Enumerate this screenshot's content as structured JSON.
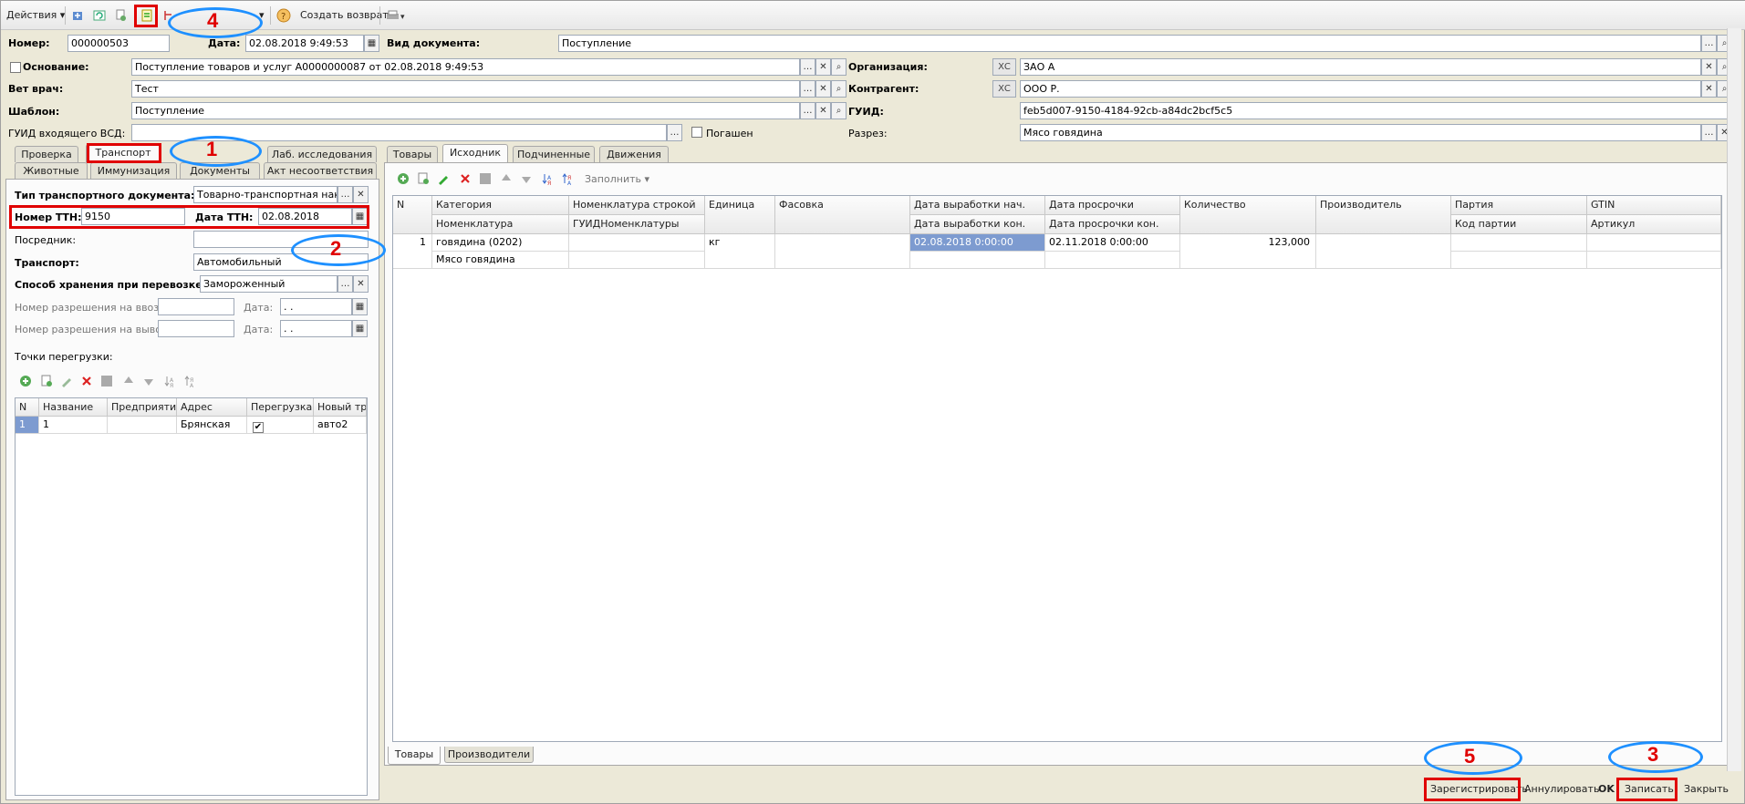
{
  "toolbar": {
    "actions": "Действия",
    "create_return": "Создать возврат"
  },
  "header": {
    "number_label": "Номер:",
    "number_value": "000000503",
    "date_label": "Дата:",
    "date_value": "02.08.2018  9:49:53",
    "doctype_label": "Вид документа:",
    "doctype_value": "Поступление",
    "basis_label": "Основание:",
    "basis_value": "Поступление товаров и услуг А0000000087 от 02.08.2018 9:49:53",
    "org_label": "Организация:",
    "org_value": "ЗАО  А",
    "vet_label": "Вет врач:",
    "vet_value": "Тест",
    "contractor_label": "Контрагент:",
    "contractor_value": "ООО Р.",
    "template_label": "Шаблон:",
    "template_value": "Поступление",
    "guid_label": "ГУИД:",
    "guid_value": "feb5d007-9150-4184-92cb-a84dc2bcf5c5",
    "incoming_guid_label": "ГУИД входящего ВСД:",
    "incoming_guid_value": "",
    "repaid_label": "Погашен",
    "cut_label": "Разрез:",
    "cut_value": "Мясо говядина",
    "xs": "ХС"
  },
  "left_tabs": {
    "row1": [
      "Проверка",
      "Транспорт",
      "Лаб. исследования"
    ],
    "row2": [
      "Животные",
      "Иммунизация",
      "Документы",
      "Акт несоответствия"
    ]
  },
  "transport": {
    "doc_type_label": "Тип транспортного документа:",
    "doc_type_value": "Товарно-транспортная наклад",
    "ttn_number_label": "Номер ТТН:",
    "ttn_number_value": "9150",
    "ttn_date_label": "Дата ТТН:",
    "ttn_date_value": "02.08.2018",
    "intermediary_label": "Посредник:",
    "intermediary_value": "",
    "transport_label": "Транспорт:",
    "transport_value": "Автомобильный",
    "storage_label": "Способ хранения при перевозке:",
    "storage_value": "Замороженный",
    "import_permit_label": "Номер разрешения на ввоз:",
    "export_permit_label": "Номер разрешения на вывоз:",
    "date_label": "Дата:",
    "date_placeholder": " .  .",
    "transship_label": "Точки перегрузки:",
    "grid_headers": [
      "N",
      "Название",
      "Предприятие",
      "Адрес",
      "Перегрузка",
      "Новый тра"
    ],
    "grid_row": [
      "1",
      "1",
      "",
      "Брянская",
      "✔",
      "авто2"
    ]
  },
  "right_tabs": [
    "Товары",
    "Исходник",
    "Подчиненные",
    "Движения"
  ],
  "goods": {
    "fill_label": "Заполнить",
    "headers_top": [
      "N",
      "Категория",
      "Номенклатура строкой",
      "Единица",
      "Фасовка",
      "Дата выработки нач.",
      "Дата просрочки",
      "Количество",
      "Производитель",
      "Партия",
      "GTIN"
    ],
    "headers_bottom": [
      "Номенклатура",
      "ГУИДНоменклатуры",
      "Дата выработки кон.",
      "Дата просрочки кон.",
      "Код партии",
      "Артикул"
    ],
    "row": {
      "n": "1",
      "category": "говядина (0202)",
      "nomenclature": "Мясо говядина",
      "unit": "кг",
      "prod_date": "02.08.2018 0:00:00",
      "expiry": "02.11.2018 0:00:00",
      "qty": "123,000"
    },
    "bottom_tabs": [
      "Товары",
      "Производители"
    ]
  },
  "footer": {
    "register": "Зарегистрировать",
    "cancel": "Аннулировать",
    "ok": "OK",
    "save": "Записать",
    "close": "Закрыть"
  },
  "annotations": [
    "1",
    "2",
    "3",
    "4",
    "5"
  ]
}
